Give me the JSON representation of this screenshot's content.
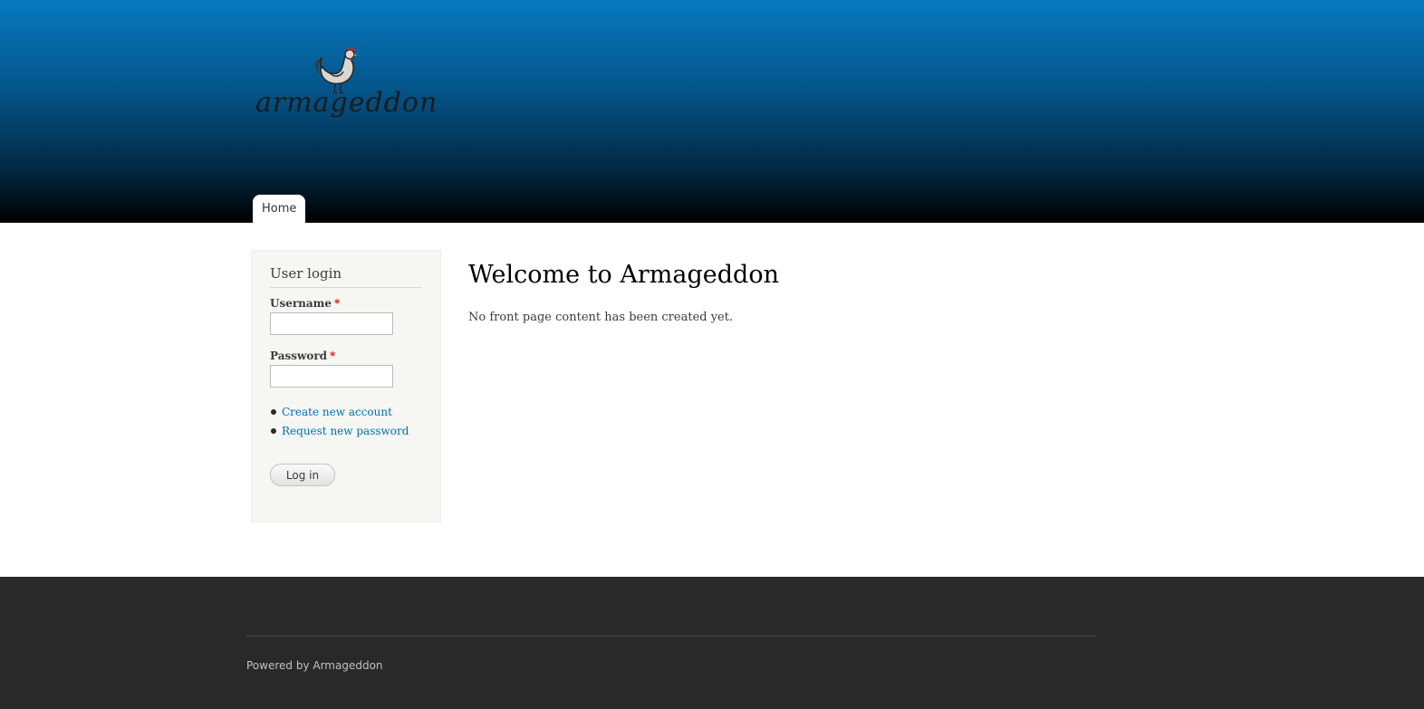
{
  "header": {
    "logo_text": "armageddon",
    "nav": [
      {
        "label": "Home"
      }
    ],
    "gradient_colors": [
      "#0779bf",
      "#000000"
    ]
  },
  "sidebar": {
    "title": "User login",
    "username_label": "Username",
    "password_label": "Password",
    "required_marker": "*",
    "links": [
      {
        "label": "Create new account"
      },
      {
        "label": "Request new password"
      }
    ],
    "login_button": "Log in"
  },
  "main": {
    "title": "Welcome to Armageddon",
    "text": "No front page content has been created yet."
  },
  "footer": {
    "text": "Powered by Armageddon"
  },
  "colors": {
    "link": "#0071b3",
    "required": "#ee0000",
    "footer_bg": "#292929",
    "sidebar_bg": "#f6f6f2"
  }
}
